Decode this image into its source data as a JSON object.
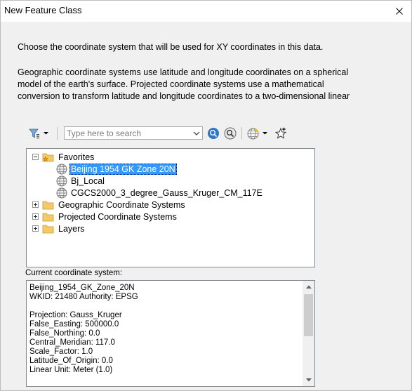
{
  "window": {
    "title": "New Feature Class"
  },
  "intro": {
    "line1": "Choose the coordinate system that will be used for XY coordinates in this data."
  },
  "description": {
    "lines": [
      "Geographic coordinate systems use latitude and longitude coordinates on a spherical",
      "model of the earth's surface. Projected coordinate systems use a mathematical",
      "conversion to transform latitude and longitude coordinates to a two-dimensional linear"
    ]
  },
  "toolbar": {
    "search_placeholder": "Type here to search"
  },
  "tree": {
    "favorites": {
      "label": "Favorites",
      "items": [
        "Beijing 1954 GK Zone 20N",
        "Bj_Local",
        "CGCS2000_3_degree_Gauss_Kruger_CM_117E"
      ]
    },
    "folders": [
      "Geographic Coordinate Systems",
      "Projected Coordinate Systems",
      "Layers"
    ]
  },
  "current": {
    "label": "Current coordinate system:",
    "lines": [
      "Beijing_1954_GK_Zone_20N",
      "WKID: 21480 Authority: EPSG",
      "",
      "Projection: Gauss_Kruger",
      "False_Easting: 500000.0",
      "False_Northing: 0.0",
      "Central_Meridian: 117.0",
      "Scale_Factor: 1.0",
      "Latitude_Of_Origin: 0.0",
      "Linear Unit: Meter (1.0)"
    ]
  },
  "colors": {
    "selection": "#3399ff",
    "folder": "#f5c96a",
    "globe": "#8a8a8a"
  }
}
